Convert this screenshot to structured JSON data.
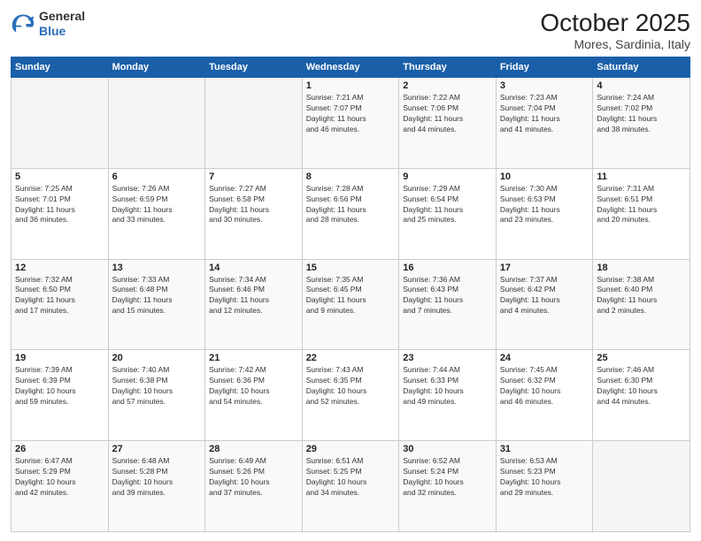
{
  "logo": {
    "general": "General",
    "blue": "Blue"
  },
  "header": {
    "title": "October 2025",
    "subtitle": "Mores, Sardinia, Italy"
  },
  "weekdays": [
    "Sunday",
    "Monday",
    "Tuesday",
    "Wednesday",
    "Thursday",
    "Friday",
    "Saturday"
  ],
  "weeks": [
    [
      {
        "day": "",
        "info": ""
      },
      {
        "day": "",
        "info": ""
      },
      {
        "day": "",
        "info": ""
      },
      {
        "day": "1",
        "info": "Sunrise: 7:21 AM\nSunset: 7:07 PM\nDaylight: 11 hours\nand 46 minutes."
      },
      {
        "day": "2",
        "info": "Sunrise: 7:22 AM\nSunset: 7:06 PM\nDaylight: 11 hours\nand 44 minutes."
      },
      {
        "day": "3",
        "info": "Sunrise: 7:23 AM\nSunset: 7:04 PM\nDaylight: 11 hours\nand 41 minutes."
      },
      {
        "day": "4",
        "info": "Sunrise: 7:24 AM\nSunset: 7:02 PM\nDaylight: 11 hours\nand 38 minutes."
      }
    ],
    [
      {
        "day": "5",
        "info": "Sunrise: 7:25 AM\nSunset: 7:01 PM\nDaylight: 11 hours\nand 36 minutes."
      },
      {
        "day": "6",
        "info": "Sunrise: 7:26 AM\nSunset: 6:59 PM\nDaylight: 11 hours\nand 33 minutes."
      },
      {
        "day": "7",
        "info": "Sunrise: 7:27 AM\nSunset: 6:58 PM\nDaylight: 11 hours\nand 30 minutes."
      },
      {
        "day": "8",
        "info": "Sunrise: 7:28 AM\nSunset: 6:56 PM\nDaylight: 11 hours\nand 28 minutes."
      },
      {
        "day": "9",
        "info": "Sunrise: 7:29 AM\nSunset: 6:54 PM\nDaylight: 11 hours\nand 25 minutes."
      },
      {
        "day": "10",
        "info": "Sunrise: 7:30 AM\nSunset: 6:53 PM\nDaylight: 11 hours\nand 23 minutes."
      },
      {
        "day": "11",
        "info": "Sunrise: 7:31 AM\nSunset: 6:51 PM\nDaylight: 11 hours\nand 20 minutes."
      }
    ],
    [
      {
        "day": "12",
        "info": "Sunrise: 7:32 AM\nSunset: 6:50 PM\nDaylight: 11 hours\nand 17 minutes."
      },
      {
        "day": "13",
        "info": "Sunrise: 7:33 AM\nSunset: 6:48 PM\nDaylight: 11 hours\nand 15 minutes."
      },
      {
        "day": "14",
        "info": "Sunrise: 7:34 AM\nSunset: 6:46 PM\nDaylight: 11 hours\nand 12 minutes."
      },
      {
        "day": "15",
        "info": "Sunrise: 7:35 AM\nSunset: 6:45 PM\nDaylight: 11 hours\nand 9 minutes."
      },
      {
        "day": "16",
        "info": "Sunrise: 7:36 AM\nSunset: 6:43 PM\nDaylight: 11 hours\nand 7 minutes."
      },
      {
        "day": "17",
        "info": "Sunrise: 7:37 AM\nSunset: 6:42 PM\nDaylight: 11 hours\nand 4 minutes."
      },
      {
        "day": "18",
        "info": "Sunrise: 7:38 AM\nSunset: 6:40 PM\nDaylight: 11 hours\nand 2 minutes."
      }
    ],
    [
      {
        "day": "19",
        "info": "Sunrise: 7:39 AM\nSunset: 6:39 PM\nDaylight: 10 hours\nand 59 minutes."
      },
      {
        "day": "20",
        "info": "Sunrise: 7:40 AM\nSunset: 6:38 PM\nDaylight: 10 hours\nand 57 minutes."
      },
      {
        "day": "21",
        "info": "Sunrise: 7:42 AM\nSunset: 6:36 PM\nDaylight: 10 hours\nand 54 minutes."
      },
      {
        "day": "22",
        "info": "Sunrise: 7:43 AM\nSunset: 6:35 PM\nDaylight: 10 hours\nand 52 minutes."
      },
      {
        "day": "23",
        "info": "Sunrise: 7:44 AM\nSunset: 6:33 PM\nDaylight: 10 hours\nand 49 minutes."
      },
      {
        "day": "24",
        "info": "Sunrise: 7:45 AM\nSunset: 6:32 PM\nDaylight: 10 hours\nand 46 minutes."
      },
      {
        "day": "25",
        "info": "Sunrise: 7:46 AM\nSunset: 6:30 PM\nDaylight: 10 hours\nand 44 minutes."
      }
    ],
    [
      {
        "day": "26",
        "info": "Sunrise: 6:47 AM\nSunset: 5:29 PM\nDaylight: 10 hours\nand 42 minutes."
      },
      {
        "day": "27",
        "info": "Sunrise: 6:48 AM\nSunset: 5:28 PM\nDaylight: 10 hours\nand 39 minutes."
      },
      {
        "day": "28",
        "info": "Sunrise: 6:49 AM\nSunset: 5:26 PM\nDaylight: 10 hours\nand 37 minutes."
      },
      {
        "day": "29",
        "info": "Sunrise: 6:51 AM\nSunset: 5:25 PM\nDaylight: 10 hours\nand 34 minutes."
      },
      {
        "day": "30",
        "info": "Sunrise: 6:52 AM\nSunset: 5:24 PM\nDaylight: 10 hours\nand 32 minutes."
      },
      {
        "day": "31",
        "info": "Sunrise: 6:53 AM\nSunset: 5:23 PM\nDaylight: 10 hours\nand 29 minutes."
      },
      {
        "day": "",
        "info": ""
      }
    ]
  ]
}
